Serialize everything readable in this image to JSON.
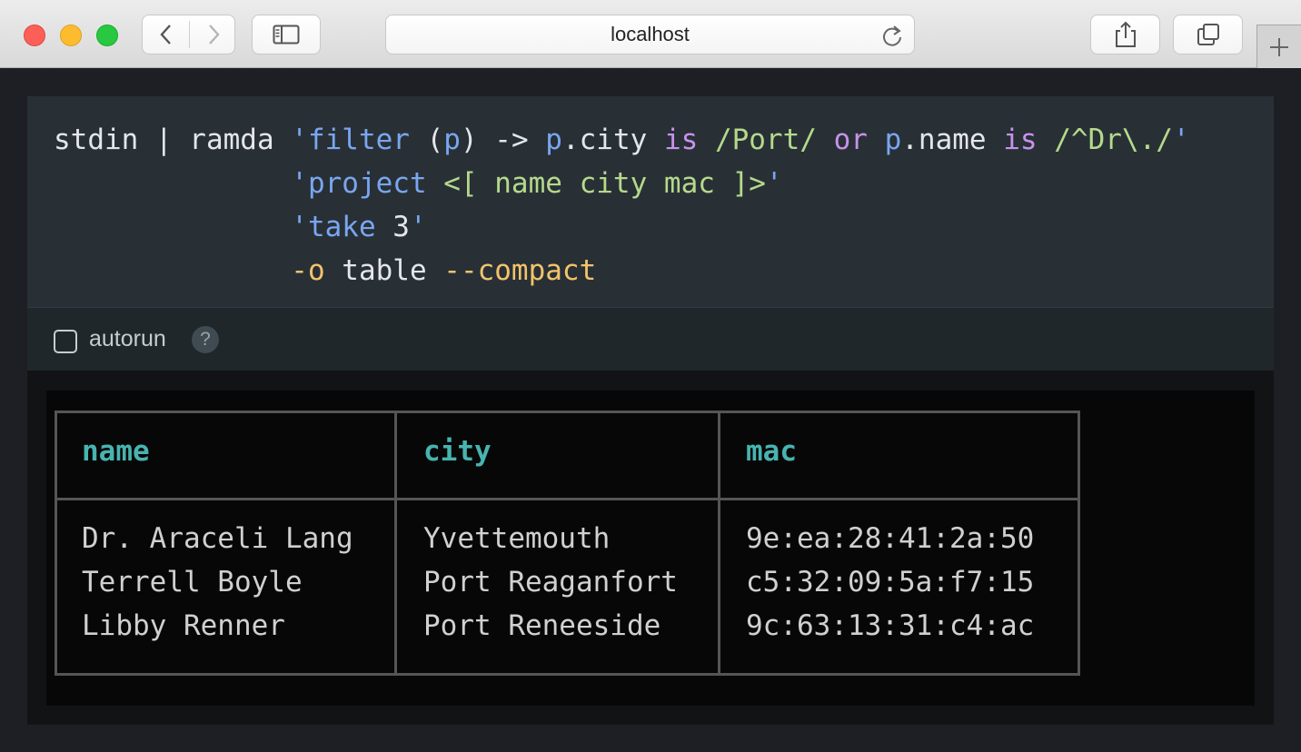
{
  "browser": {
    "url": "localhost",
    "back_icon": "chevron-left-icon",
    "forward_icon": "chevron-right-icon",
    "sidebar_icon": "sidebar-icon",
    "reload_icon": "reload-icon",
    "share_icon": "share-icon",
    "tabs_icon": "tabs-icon",
    "newtab_icon": "plus-icon"
  },
  "editor": {
    "lines": [
      [
        {
          "t": "stdin | ramda ",
          "c": "plain"
        },
        {
          "t": "'filter ",
          "c": "str"
        },
        {
          "t": "(",
          "c": "plain"
        },
        {
          "t": "p",
          "c": "var"
        },
        {
          "t": ") -> ",
          "c": "plain"
        },
        {
          "t": "p",
          "c": "var"
        },
        {
          "t": ".city ",
          "c": "plain"
        },
        {
          "t": "is ",
          "c": "kw"
        },
        {
          "t": "/Port/ ",
          "c": "grn"
        },
        {
          "t": "or ",
          "c": "kw"
        },
        {
          "t": "p",
          "c": "var"
        },
        {
          "t": ".name ",
          "c": "plain"
        },
        {
          "t": "is ",
          "c": "kw"
        },
        {
          "t": "/^Dr\\./",
          "c": "grn"
        },
        {
          "t": "'",
          "c": "str"
        }
      ],
      [
        {
          "t": "              ",
          "c": "plain"
        },
        {
          "t": "'project ",
          "c": "str"
        },
        {
          "t": "<[ name city mac ]>",
          "c": "grn"
        },
        {
          "t": "'",
          "c": "str"
        }
      ],
      [
        {
          "t": "              ",
          "c": "plain"
        },
        {
          "t": "'take ",
          "c": "str"
        },
        {
          "t": "3",
          "c": "num"
        },
        {
          "t": "'",
          "c": "str"
        }
      ],
      [
        {
          "t": "              ",
          "c": "plain"
        },
        {
          "t": "-o ",
          "c": "opt"
        },
        {
          "t": "table ",
          "c": "plain"
        },
        {
          "t": "--compact",
          "c": "opt"
        }
      ]
    ]
  },
  "toolbar": {
    "autorun_label": "autorun",
    "autorun_checked": false,
    "help_label": "?"
  },
  "output": {
    "columns": [
      "name",
      "city",
      "mac"
    ],
    "rows": [
      [
        "Dr. Araceli Lang",
        "Yvettemouth",
        "9e:ea:28:41:2a:50"
      ],
      [
        "Terrell Boyle",
        "Port Reaganfort",
        "c5:32:09:5a:f7:15"
      ],
      [
        "Libby Renner",
        "Port Reneeside",
        "9c:63:13:31:c4:ac"
      ]
    ]
  },
  "colors": {
    "header_teal": "#48b3b0",
    "string_blue": "#7aa6f0",
    "keyword_purple": "#c792ea",
    "literal_green": "#b5d98b",
    "option_orange": "#f5c36b"
  }
}
